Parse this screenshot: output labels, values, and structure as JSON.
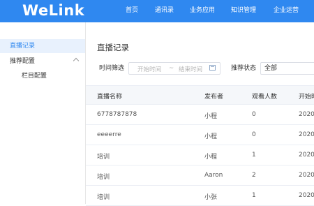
{
  "brand": {
    "logo": "WeLink"
  },
  "nav": [
    {
      "label": "首页"
    },
    {
      "label": "通讯录"
    },
    {
      "label": "业务应用"
    },
    {
      "label": "知识管理"
    },
    {
      "label": "企业运营"
    }
  ],
  "sidebar": {
    "items": [
      {
        "label": "直播记录",
        "active": true
      },
      {
        "label": "推荐配置"
      },
      {
        "label": "栏目配置"
      }
    ]
  },
  "page": {
    "title": "直播记录",
    "filter": {
      "time_label": "时间筛选",
      "start_placeholder": "开始时间",
      "separator": "~",
      "end_placeholder": "结束时间",
      "status_label": "推荐状态",
      "status_value": "全部"
    }
  },
  "table": {
    "columns": [
      "直播名称",
      "发布者",
      "观看人数",
      "开始时"
    ],
    "rows": [
      {
        "name": "6778787878",
        "publisher": "小程",
        "viewers": "0",
        "start": "2020/"
      },
      {
        "name": "eeeerre",
        "publisher": "小程",
        "viewers": "0",
        "start": "2020/"
      },
      {
        "name": "培训",
        "publisher": "小程",
        "viewers": "1",
        "start": "2020/"
      },
      {
        "name": "培训",
        "publisher": "Aaron",
        "viewers": "2",
        "start": "2020/"
      },
      {
        "name": "培训",
        "publisher": "小张",
        "viewers": "1",
        "start": "2020/"
      }
    ]
  },
  "colors": {
    "brand_blue": "#2f88f0",
    "active_bg": "#e8f1fd"
  }
}
